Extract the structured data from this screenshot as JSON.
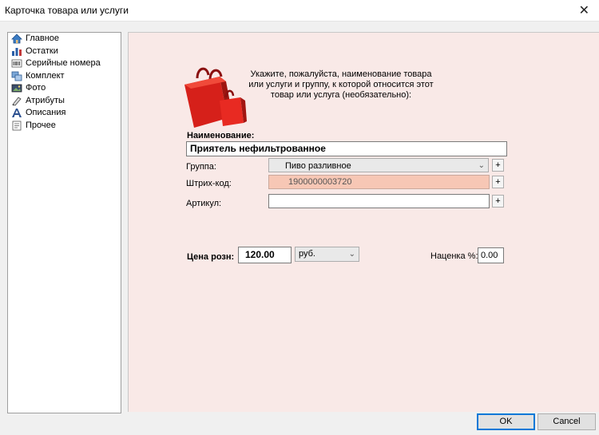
{
  "window": {
    "title": "Карточка товара или услуги",
    "close_glyph": "✕"
  },
  "sidebar": {
    "items": [
      {
        "label": "Главное",
        "icon": "home-icon",
        "selected": true
      },
      {
        "label": "Остатки",
        "icon": "stock-chart-icon",
        "selected": false
      },
      {
        "label": "Серийные номера",
        "icon": "serial-numbers-icon",
        "selected": false
      },
      {
        "label": "Комплект",
        "icon": "kit-icon",
        "selected": false
      },
      {
        "label": "Фото",
        "icon": "photo-icon",
        "selected": false
      },
      {
        "label": "Атрибуты",
        "icon": "attributes-icon",
        "selected": false
      },
      {
        "label": "Описания",
        "icon": "description-icon",
        "selected": false
      },
      {
        "label": "Прочее",
        "icon": "other-icon",
        "selected": false
      }
    ]
  },
  "main": {
    "hint": "Укажите, пожалуйста, наименование товара или услуги и группу, к которой относится этот товар или услуга (необязательно):",
    "name_label": "Наименование:",
    "name_value": "Приятель нефильтрованное",
    "group_label": "Группа:",
    "group_value": "Пиво разливное",
    "barcode_label": "Штрих-код:",
    "barcode_value": "1900000003720",
    "article_label": "Артикул:",
    "article_value": "",
    "plus_glyph": "+",
    "price_label": "Цена розн:",
    "price_value": "120.00",
    "currency_value": "руб.",
    "markup_label": "Наценка %:",
    "markup_value": "0.00"
  },
  "buttons": {
    "ok": "OK",
    "cancel": "Cancel"
  },
  "colors": {
    "panel_bg": "#f9e9e7",
    "barcode_bg": "#f7c7b5",
    "accent": "#0078d7"
  }
}
